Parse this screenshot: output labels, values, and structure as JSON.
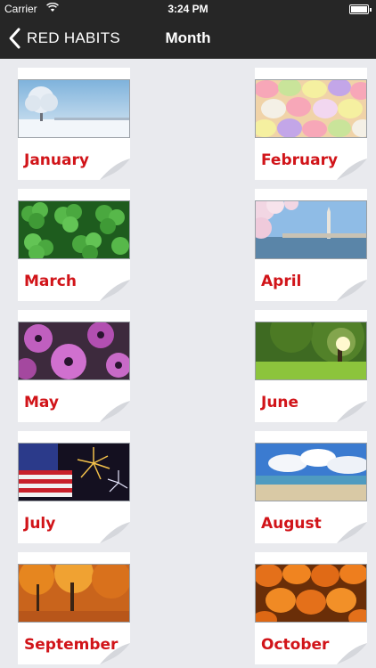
{
  "status": {
    "carrier": "Carrier",
    "time": "3:24 PM"
  },
  "nav": {
    "back_label": "RED HABITS",
    "title": "Month"
  },
  "months": [
    {
      "name": "January",
      "image": "winter-tree-snow-photo"
    },
    {
      "name": "February",
      "image": "candy-hearts-photo"
    },
    {
      "name": "March",
      "image": "clover-leaves-photo"
    },
    {
      "name": "April",
      "image": "cherry-blossom-monument-photo"
    },
    {
      "name": "May",
      "image": "purple-daisies-photo"
    },
    {
      "name": "June",
      "image": "sunlit-tree-meadow-photo"
    },
    {
      "name": "July",
      "image": "flag-fireworks-photo"
    },
    {
      "name": "August",
      "image": "beach-clouds-photo"
    },
    {
      "name": "September",
      "image": "autumn-trees-photo"
    },
    {
      "name": "October",
      "image": "pumpkins-photo"
    }
  ],
  "colors": {
    "nav_bg": "#262626",
    "month_text": "#d11419",
    "page_bg": "#e9eaee"
  }
}
